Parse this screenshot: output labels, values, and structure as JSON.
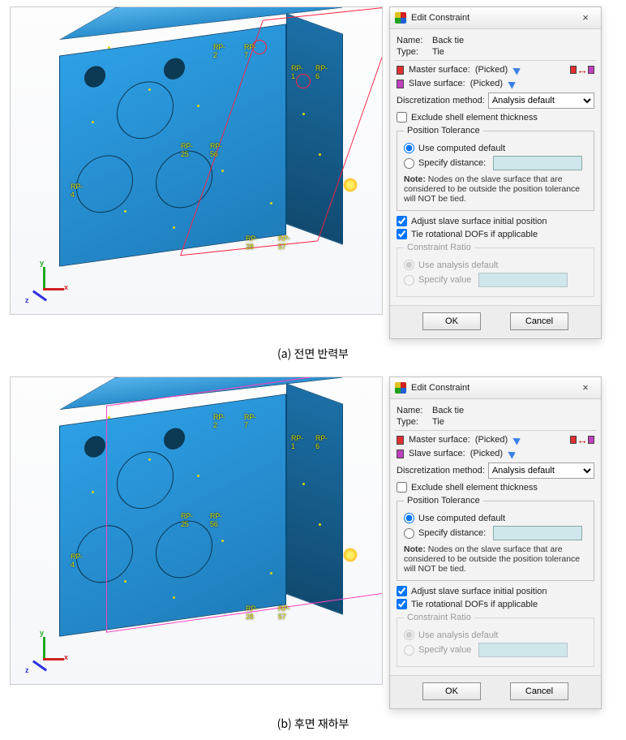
{
  "captions": {
    "a": "(a) 전면 반력부",
    "b": "(b) 후면 재하부"
  },
  "refpoints": {
    "rp1": "RP-1",
    "rp2": "RP-2",
    "rp4": "RP-4",
    "rp6": "RP-6",
    "rp7": "RP-7",
    "rp25": "RP-25",
    "rp28": "RP-28",
    "rp56": "RP-56",
    "rp57": "RP-57"
  },
  "triad": {
    "x": "x",
    "y": "y",
    "z": "z"
  },
  "dialog": {
    "title": "Edit Constraint",
    "close": "×",
    "name_label": "Name:",
    "name_value": "Back tie",
    "type_label": "Type:",
    "type_value": "Tie",
    "master_label": "Master surface:",
    "slave_label": "Slave surface:",
    "picked": "(Picked)",
    "swap": "↔",
    "discret_label": "Discretization method:",
    "discret_value": "Analysis default",
    "exclude_shell": "Exclude shell element thickness",
    "pos_tol_group": "Position Tolerance",
    "use_computed": "Use computed default",
    "specify_distance": "Specify distance:",
    "note_label": "Note:",
    "note_text": "Nodes on the slave surface that are considered to be outside the position tolerance will NOT be tied.",
    "adjust_slave": "Adjust slave surface initial position",
    "tie_rot": "Tie rotational DOFs if applicable",
    "ratio_group": "Constraint Ratio",
    "use_analysis_default": "Use analysis default",
    "specify_value": "Specify value",
    "ok": "OK",
    "cancel": "Cancel"
  }
}
